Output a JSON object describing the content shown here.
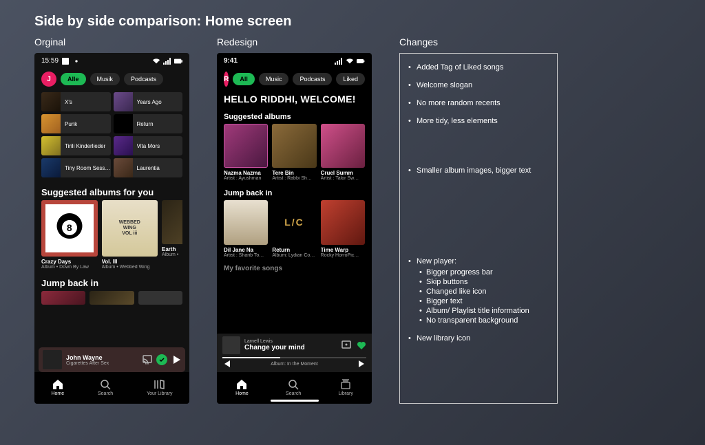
{
  "page_title": "Side by side comparison: Home screen",
  "columns": {
    "original": "Orginal",
    "redesign": "Redesign",
    "changes": "Changes"
  },
  "original": {
    "time": "15:59",
    "avatar_letter": "J",
    "filters": [
      "Alle",
      "Musik",
      "Podcasts"
    ],
    "recents": [
      "X's",
      "Years Ago",
      "Punk",
      "Return",
      "Tirili Kinderlieder",
      "Vita Mors",
      "Tiny Room Sessions",
      "Laurentia"
    ],
    "suggested_heading": "Suggested albums for you",
    "suggested": [
      {
        "title": "Crazy Days",
        "sub": "Album • Down By Law"
      },
      {
        "title": "Vol. III",
        "sub": "Album • Webbed Wing"
      },
      {
        "title": "Earth",
        "sub": "Album •"
      }
    ],
    "jump_heading": "Jump back in",
    "now_playing": {
      "title": "John Wayne",
      "sub": "Cigarettes After Sex"
    },
    "nav": [
      "Home",
      "Search",
      "Your Library"
    ]
  },
  "redesign": {
    "time": "9:41",
    "avatar_letter": "R",
    "filters": [
      "All",
      "Music",
      "Podcasts",
      "Liked"
    ],
    "welcome": "HELLO RIDDHI, WELCOME!",
    "suggested_heading": "Suggested albums",
    "suggested": [
      {
        "title": "Nazma Nazma",
        "sub": "Artist : Ayushman"
      },
      {
        "title": "Tere Bin",
        "sub": "Artist : Rabbi Sh…"
      },
      {
        "title": "Cruel Summ",
        "sub": "Artist : Talor Sw…"
      }
    ],
    "jump_heading": "Jump back in",
    "jump": [
      {
        "title": "Dil Jane Na",
        "sub": "Artist : Sharib To…"
      },
      {
        "title": "Return",
        "sub": "Album: Lydian Co…"
      },
      {
        "title": "Time Warp",
        "sub": "Rocky HorroPic…"
      }
    ],
    "fav_heading": "My favorite songs",
    "now_playing": {
      "artist": "Larnell Lewis",
      "title": "Change your mind",
      "album_line": "Album: In the Moment"
    },
    "nav": [
      "Home",
      "Search",
      "Library"
    ]
  },
  "changes": [
    "Added Tag of Liked songs",
    "Welcome slogan",
    "No more random recents",
    "More tidy, less elements",
    "Smaller album images, bigger text",
    "New player:",
    "New library icon"
  ],
  "player_sub": [
    "Bigger progress bar",
    "Skip buttons",
    "Changed like icon",
    "Bigger text",
    "Album/ Playlist title information",
    "No transparent background"
  ]
}
